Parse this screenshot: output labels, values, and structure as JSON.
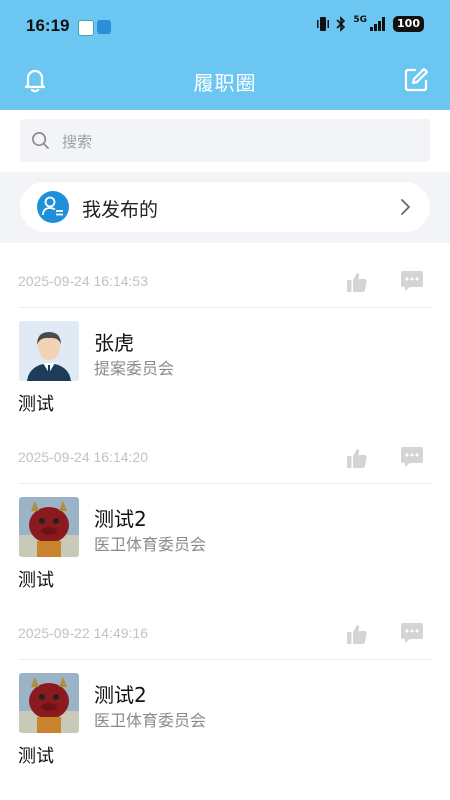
{
  "status_bar": {
    "time": "16:19",
    "network": "5G",
    "battery": "100"
  },
  "header": {
    "title": "履职圈",
    "left_icon": "bell-icon",
    "right_icon": "edit-icon",
    "color": "#6cc6f2"
  },
  "search": {
    "placeholder": "搜索"
  },
  "mine": {
    "label": "我发布的",
    "icon": "user-list-icon",
    "accent": "#1e8fd8"
  },
  "posts": [
    {
      "time": "2025-09-24 16:14:53",
      "author": "张虎",
      "org": "提案委员会",
      "content": "测试",
      "avatar": "person-avatar"
    },
    {
      "time": "2025-09-24 16:14:20",
      "author": "测试2",
      "org": "医卫体育委员会",
      "content": "测试",
      "avatar": "dragon-avatar"
    },
    {
      "time": "2025-09-22 14:49:16",
      "author": "测试2",
      "org": "医卫体育委员会",
      "content": "测试",
      "avatar": "dragon-avatar"
    }
  ]
}
